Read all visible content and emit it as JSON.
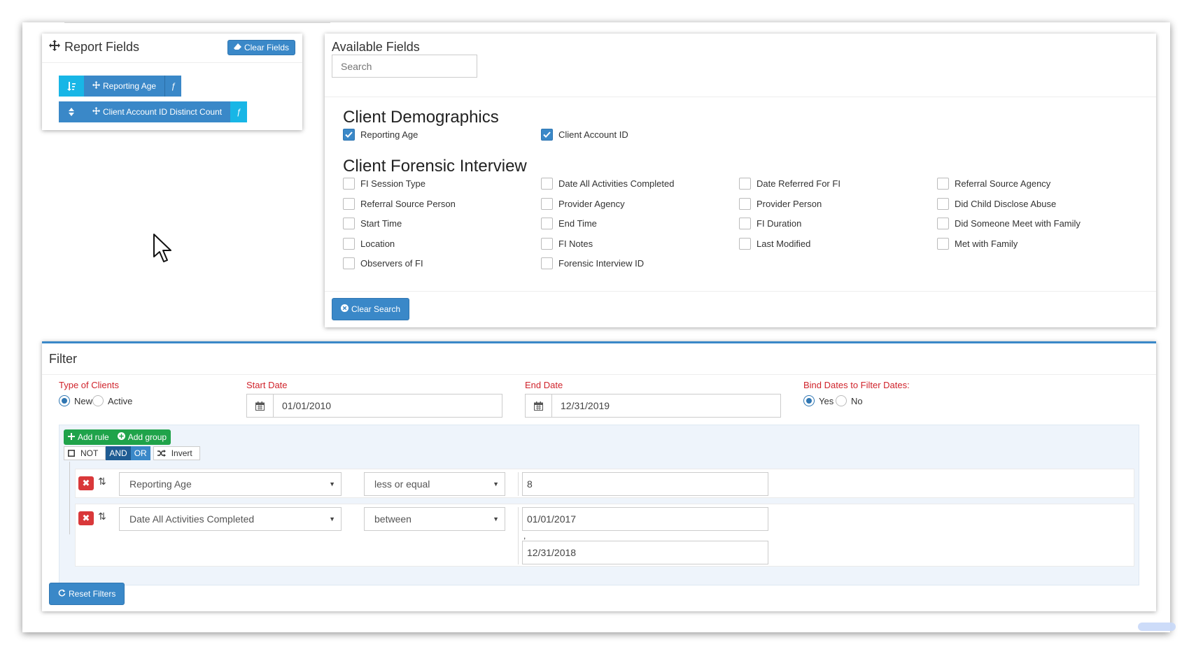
{
  "report_fields": {
    "title": "Report Fields",
    "clear_label": "Clear Fields",
    "items": [
      {
        "label": "Reporting Age",
        "fx": "ƒ"
      },
      {
        "label": "Client Account ID Distinct Count",
        "fx": "ƒ"
      }
    ]
  },
  "available_fields": {
    "title": "Available Fields",
    "search_placeholder": "Search",
    "clear_search_label": "Clear Search",
    "sections": [
      {
        "title": "Client Demographics",
        "fields": [
          {
            "label": "Reporting Age",
            "checked": true
          },
          {
            "label": "Client Account ID",
            "checked": true
          }
        ]
      },
      {
        "title": "Client Forensic Interview",
        "fields": [
          {
            "label": "FI Session Type",
            "checked": false
          },
          {
            "label": "Date All Activities Completed",
            "checked": false
          },
          {
            "label": "Date Referred For FI",
            "checked": false
          },
          {
            "label": "Referral Source Agency",
            "checked": false
          },
          {
            "label": "Referral Source Person",
            "checked": false
          },
          {
            "label": "Provider Agency",
            "checked": false
          },
          {
            "label": "Provider Person",
            "checked": false
          },
          {
            "label": "Did Child Disclose Abuse",
            "checked": false
          },
          {
            "label": "Start Time",
            "checked": false
          },
          {
            "label": "End Time",
            "checked": false
          },
          {
            "label": "FI Duration",
            "checked": false
          },
          {
            "label": "Did Someone Meet with Family",
            "checked": false
          },
          {
            "label": "Location",
            "checked": false
          },
          {
            "label": "FI Notes",
            "checked": false
          },
          {
            "label": "Last Modified",
            "checked": false
          },
          {
            "label": "Met with Family",
            "checked": false
          },
          {
            "label": "Observers of FI",
            "checked": false
          },
          {
            "label": "Forensic Interview ID",
            "checked": false
          }
        ]
      }
    ]
  },
  "filter": {
    "title": "Filter",
    "type_label": "Type of Clients",
    "type_options": [
      "New",
      "Active"
    ],
    "type_selected": "New",
    "start_label": "Start Date",
    "start_value": "01/01/2010",
    "end_label": "End Date",
    "end_value": "12/31/2019",
    "bind_label": "Bind Dates to Filter Dates:",
    "bind_options": [
      "Yes",
      "No"
    ],
    "bind_selected": "Yes",
    "add_rule": "Add rule",
    "add_group": "Add group",
    "cond_not": "NOT",
    "cond_and": "AND",
    "cond_or": "OR",
    "invert": "Invert",
    "rules": [
      {
        "field": "Reporting Age",
        "operator": "less or equal",
        "value": "8"
      },
      {
        "field": "Date All Activities Completed",
        "operator": "between",
        "value": "01/01/2017",
        "value2": "12/31/2018",
        "sep": ","
      }
    ],
    "reset_label": "Reset Filters"
  },
  "colors": {
    "primary": "#3a88c8",
    "info": "#18b6e6",
    "success": "#1fa34a",
    "danger": "#d9383a",
    "label_red": "#d0232b"
  }
}
